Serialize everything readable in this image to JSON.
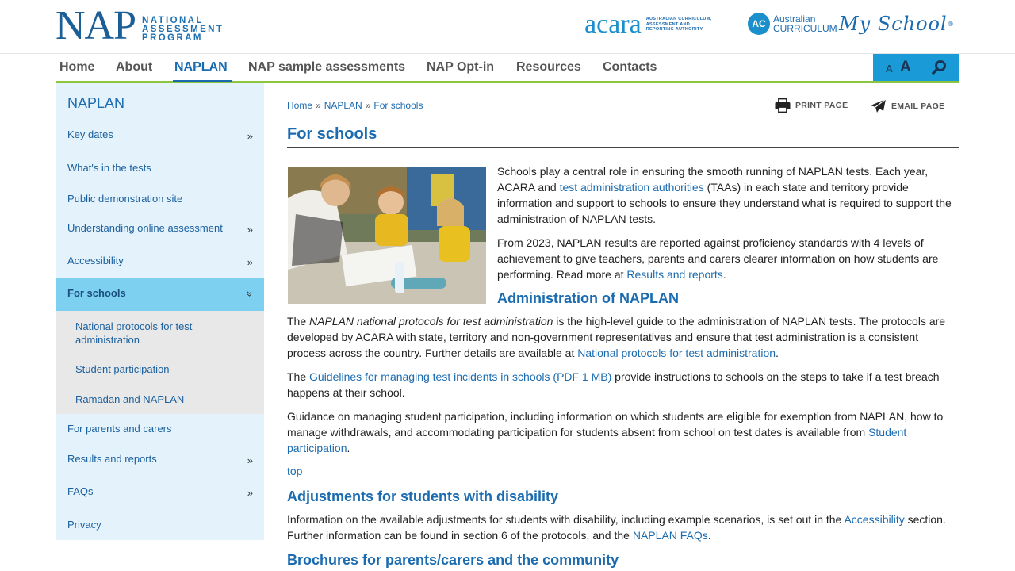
{
  "header": {
    "logo_main": "NAP",
    "logo_lines": [
      "NATIONAL",
      "ASSESSMENT",
      "PROGRAM"
    ],
    "acara_word": "acara",
    "acara_tagline": "Australian Curriculum, Assessment and Reporting Authority",
    "ac_badge": "AC",
    "ac_text_1": "Australian",
    "ac_text_2": "CURRICULUM",
    "myschool": "My School",
    "myschool_mark": "®"
  },
  "nav": {
    "items": [
      "Home",
      "About",
      "NAPLAN",
      "NAP sample assessments",
      "NAP Opt-in",
      "Resources",
      "Contacts"
    ],
    "active_index": 2,
    "font_small": "A",
    "font_large": "A"
  },
  "sidebar": {
    "title": "NAPLAN",
    "items": [
      {
        "label": "Key dates",
        "chevron": "»"
      },
      {
        "label": "What's in the tests",
        "chevron": ""
      },
      {
        "label": "Public demonstration site",
        "chevron": ""
      },
      {
        "label": "Understanding online assessment",
        "chevron": "»"
      },
      {
        "label": "Accessibility",
        "chevron": "»"
      },
      {
        "label": "For schools",
        "chevron": "»"
      },
      {
        "label": "For parents and carers",
        "chevron": ""
      },
      {
        "label": "Results and reports",
        "chevron": "»"
      },
      {
        "label": "FAQs",
        "chevron": "»"
      },
      {
        "label": "Privacy",
        "chevron": ""
      }
    ],
    "sub_items": [
      "National protocols for test administration",
      "Student participation",
      "Ramadan and NAPLAN"
    ]
  },
  "breadcrumb": [
    "Home",
    "NAPLAN",
    "For schools"
  ],
  "tools": {
    "print": "PRINT PAGE",
    "email": "EMAIL PAGE"
  },
  "main": {
    "title": "For schools",
    "intro_1": {
      "pre": "Schools play a central role in ensuring the smooth running of NAPLAN tests. Each year, ACARA and ",
      "link": "test administration authorities",
      "post": " (TAAs) in each state and territory provide information and support to schools to ensure they understand what is required to support the administration of NAPLAN tests."
    },
    "intro_2": {
      "pre": "From 2023, NAPLAN results are reported against proficiency standards with 4 levels of achievement to give teachers, parents and carers clearer information on how students are performing. Read more at ",
      "link": "Results and reports",
      "post": "."
    },
    "h_admin": "Administration of NAPLAN",
    "admin_1": {
      "pre": "The ",
      "em": "NAPLAN national protocols for test administration",
      "mid": " is the high-level guide to the administration of NAPLAN tests. The protocols are developed by ACARA with state, territory and non-government representatives and ensure that test administration is a consistent process across the country. Further details are available at ",
      "link": "National protocols for test administration",
      "post": "."
    },
    "admin_2": {
      "pre": "The ",
      "link": "Guidelines for managing test incidents in schools (PDF 1 MB)",
      "post": " provide instructions to schools on the steps to take if a test breach happens at their school."
    },
    "admin_3": {
      "pre": "Guidance on managing student participation, including information on which students are eligible for exemption from NAPLAN, how to manage withdrawals, and accommodating participation for students absent from school on test dates is available from ",
      "link": "Student participation",
      "post": "."
    },
    "top": "top",
    "h_adjust": "Adjustments for students with disability",
    "adjust_1": {
      "pre": "Information on the available adjustments for students with disability, including example scenarios, is set out in the ",
      "link1": "Accessibility",
      "mid": " section. Further information can be found in section 6 of the protocols, and the ",
      "link2": "NAPLAN FAQs",
      "post": "."
    },
    "h_brochures": "Brochures for parents/carers and the community"
  },
  "colors": {
    "brand_blue": "#1a6bb0",
    "nav_green": "#8cc63f",
    "tool_blue": "#1a9ad6",
    "sidebar_bg": "#e4f3fb",
    "sidebar_active": "#7ed0f0"
  }
}
